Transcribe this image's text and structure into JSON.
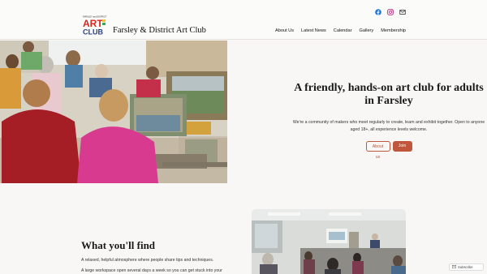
{
  "header": {
    "site_title": "Farsley & District Art Club",
    "logo_text": {
      "top": "FARSLEY and DISTRICT",
      "word1": "ART",
      "word2": "CLUB"
    },
    "social": [
      "facebook-icon",
      "instagram-icon",
      "mail-icon"
    ]
  },
  "nav": {
    "items": [
      "About Us",
      "Latest News",
      "Calendar",
      "Gallery",
      "Membership"
    ]
  },
  "hero": {
    "title": "A friendly, hands-on art club for adults in Farsley",
    "subtitle": "We're a community of makers who meet regularly to create, learn and exhibit together. Open to anyone aged 18+, all experience levels welcome.",
    "button_about": "About us",
    "button_join": "Join in"
  },
  "find": {
    "title": "What you'll find",
    "p1": "A relaxed, helpful atmosphere where people share tips and techniques.",
    "p2": "A large workspace open several days a week so you can get stuck into your"
  },
  "subscribe": {
    "label": "Subscribe"
  },
  "colors": {
    "accent": "#c0563b",
    "logo_red": "#d7261e",
    "logo_blue": "#233f8f",
    "background": "#f8f7f5"
  }
}
